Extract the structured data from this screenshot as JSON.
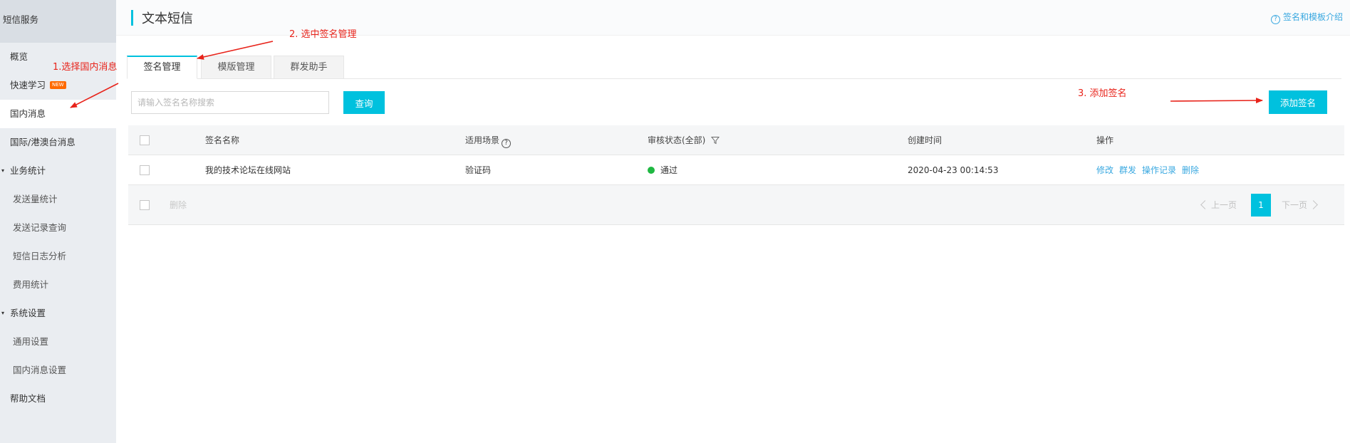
{
  "sidebar": {
    "header": "短信服务",
    "items": [
      {
        "label": "概览",
        "level": "top"
      },
      {
        "label": "快速学习",
        "level": "top",
        "badge": "NEW"
      },
      {
        "label": "国内消息",
        "level": "top",
        "active": true
      },
      {
        "label": "国际/港澳台消息",
        "level": "top"
      },
      {
        "label": "业务统计",
        "level": "group"
      },
      {
        "label": "发送量统计",
        "level": "sub"
      },
      {
        "label": "发送记录查询",
        "level": "sub"
      },
      {
        "label": "短信日志分析",
        "level": "sub"
      },
      {
        "label": "费用统计",
        "level": "sub"
      },
      {
        "label": "系统设置",
        "level": "group"
      },
      {
        "label": "通用设置",
        "level": "sub"
      },
      {
        "label": "国内消息设置",
        "level": "sub"
      },
      {
        "label": "帮助文档",
        "level": "top"
      }
    ]
  },
  "header": {
    "title": "文本短信",
    "help_link": "签名和模板介绍"
  },
  "tabs": [
    {
      "label": "签名管理",
      "active": true
    },
    {
      "label": "模版管理",
      "active": false
    },
    {
      "label": "群发助手",
      "active": false
    }
  ],
  "search": {
    "placeholder": "请输入签名名称搜索",
    "value": "",
    "button": "查询"
  },
  "add_button": "添加签名",
  "table": {
    "columns": {
      "name": "签名名称",
      "scene": "适用场景",
      "status": "审核状态(全部)",
      "created": "创建时间",
      "actions": "操作"
    },
    "rows": [
      {
        "name": "我的技术论坛在线网站",
        "scene": "验证码",
        "status": "通过",
        "status_color": "#1fb842",
        "created": "2020-04-23 00:14:53",
        "actions": [
          "修改",
          "群发",
          "操作记录",
          "删除"
        ]
      }
    ],
    "footer": {
      "batch_delete": "删除",
      "prev": "上一页",
      "page": "1",
      "next": "下一页"
    }
  },
  "annotations": {
    "step1": "1.选择国内消息",
    "step2": "2. 选中签名管理",
    "step3": "3. 添加签名",
    "color": "#e8231a"
  },
  "colors": {
    "accent": "#00c1de",
    "link": "#39a8e0",
    "sidebar_bg": "#eaedf1"
  }
}
